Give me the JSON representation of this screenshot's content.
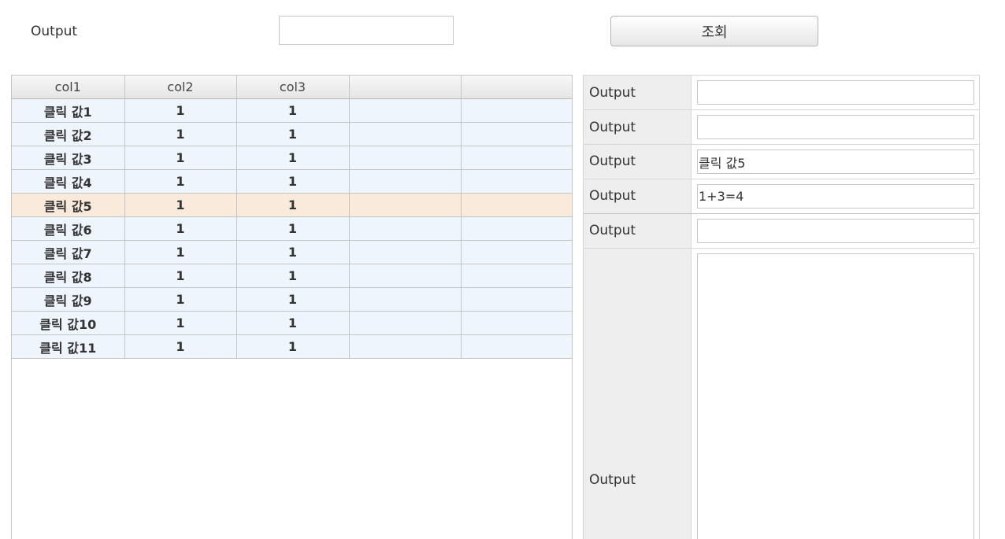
{
  "search": {
    "label": "Output",
    "value": "",
    "button_label": "조회"
  },
  "grid": {
    "columns": [
      "col1",
      "col2",
      "col3",
      "",
      ""
    ],
    "selected_row": 4,
    "rows": [
      [
        "클릭 값1",
        "1",
        "1",
        "",
        ""
      ],
      [
        "클릭 값2",
        "1",
        "1",
        "",
        ""
      ],
      [
        "클릭 값3",
        "1",
        "1",
        "",
        ""
      ],
      [
        "클릭 값4",
        "1",
        "1",
        "",
        ""
      ],
      [
        "클릭 값5",
        "1",
        "1",
        "",
        ""
      ],
      [
        "클릭 값6",
        "1",
        "1",
        "",
        ""
      ],
      [
        "클릭 값7",
        "1",
        "1",
        "",
        ""
      ],
      [
        "클릭 값8",
        "1",
        "1",
        "",
        ""
      ],
      [
        "클릭 값9",
        "1",
        "1",
        "",
        ""
      ],
      [
        "클릭 값10",
        "1",
        "1",
        "",
        ""
      ],
      [
        "클릭 값11",
        "1",
        "1",
        "",
        ""
      ]
    ]
  },
  "form": {
    "fields": [
      {
        "label": "Output",
        "value": ""
      },
      {
        "label": "Output",
        "value": ""
      },
      {
        "label": "Output",
        "value": "클릭 값5"
      },
      {
        "label": "Output",
        "value": "1+3=4"
      },
      {
        "label": "Output",
        "value": ""
      },
      {
        "label": "Output",
        "value": ""
      }
    ]
  },
  "colors": {
    "row_background": "#eef5fc",
    "selected_row_background": "#f9eadb",
    "label_cell_background": "#eeeeee"
  }
}
